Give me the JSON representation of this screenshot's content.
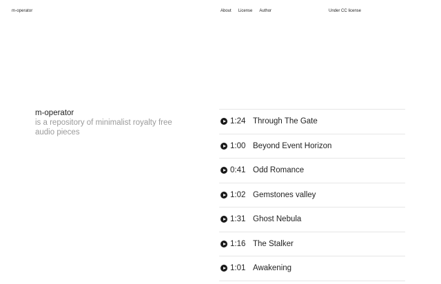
{
  "header": {
    "logo": "m-operator",
    "nav": [
      {
        "label": "About"
      },
      {
        "label": "License"
      },
      {
        "label": "Author"
      }
    ],
    "license_note": "Under CC license"
  },
  "intro": {
    "title": "m-operator",
    "description": "is a repository of minimalist royalty free audio pieces"
  },
  "tracks": [
    {
      "duration": "1:24",
      "title": "Through The Gate"
    },
    {
      "duration": "1:00",
      "title": "Beyond Event Horizon"
    },
    {
      "duration": "0:41",
      "title": "Odd Romance"
    },
    {
      "duration": "1:02",
      "title": "Gemstones valley"
    },
    {
      "duration": "1:31",
      "title": "Ghost Nebula"
    },
    {
      "duration": "1:16",
      "title": "The Stalker"
    },
    {
      "duration": "1:01",
      "title": "Awakening"
    }
  ],
  "icons": {
    "play": "play-circle-icon"
  },
  "colors": {
    "text": "#222222",
    "muted": "#9a9a9a",
    "divider": "#e6e6e6",
    "background": "#ffffff"
  }
}
